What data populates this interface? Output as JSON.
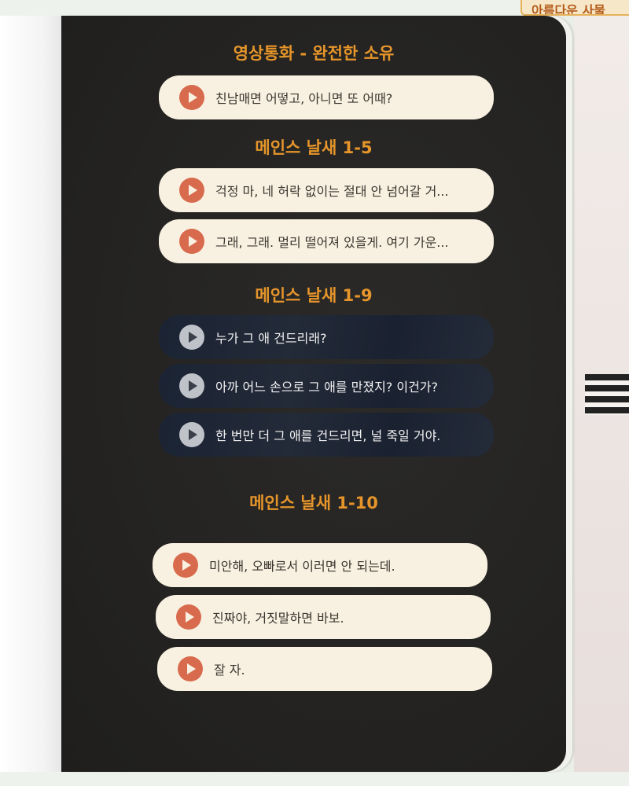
{
  "top_tab": {
    "label": "아름다운 사물"
  },
  "sections": [
    {
      "title": "영상통화 - 완전한 소유",
      "items": [
        {
          "text": "친남매면 어떻고, 아니면 또 어때?",
          "style": "light"
        }
      ]
    },
    {
      "title": "메인스 날새 1-5",
      "items": [
        {
          "text": "걱정 마, 네 허락 없이는 절대 안 넘어갈 거...",
          "style": "light"
        },
        {
          "text": "그래, 그래. 멀리 떨어져 있을게. 여기 가운...",
          "style": "light"
        }
      ]
    },
    {
      "title": "메인스 날새 1-9",
      "items": [
        {
          "text": "누가 그 애 건드리래?",
          "style": "dark"
        },
        {
          "text": "아까 어느 손으로 그 애를 만졌지? 이건가?",
          "style": "dark"
        },
        {
          "text": "한 번만 더 그 애를 건드리면, 널 죽일 거야.",
          "style": "dark"
        }
      ]
    },
    {
      "title": "메인스 날새 1-10",
      "items": [
        {
          "text": "미안해, 오빠로서 이러면 안 되는데.",
          "style": "light"
        },
        {
          "text": "진짜야, 거짓말하면 바보.",
          "style": "light"
        },
        {
          "text": "잘 자.",
          "style": "light"
        }
      ]
    }
  ],
  "colors": {
    "title_orange": "#e6952a",
    "play_light": "#d86a4d",
    "play_dark": "#bfc2c9",
    "card_light": "#f8f1e1",
    "panel_dark": "#242321"
  }
}
